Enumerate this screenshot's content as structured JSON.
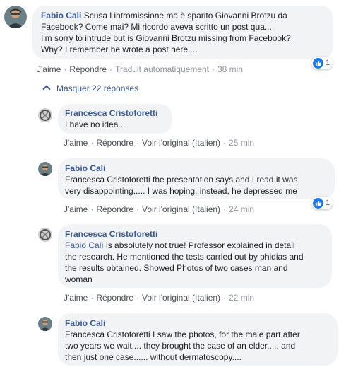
{
  "comments": [
    {
      "author": "Fabio Cali",
      "text": "Scusa l intromissione ma è sparito Giovanni Brotzu da Facebook? Come mai? Mi ricordo aveva scritto un post qua.... I'm sorry to intrude but is Giovanni Brotzu missing from Facebook? Why? I remember he wrote a post here....",
      "lines": [
        "Scusa l intromissione ma è sparito Giovanni Brotzu da",
        "Facebook? Come mai? Mi ricordo aveva scritto un post qua....",
        "I'm sorry to intrude but is Giovanni Brotzu missing from Facebook?",
        "Why? I remember he wrote a post here...."
      ],
      "actions": {
        "like": "J'aime",
        "reply": "Répondre",
        "translate": "Traduit automatiquement",
        "time": "38 min"
      },
      "reaction_count": "1"
    },
    {
      "author": "Francesca Cristoforetti",
      "lines": [
        "I have no idea..."
      ],
      "actions": {
        "like": "J'aime",
        "reply": "Répondre",
        "original": "Voir l'original (Italien)",
        "time": "25 min"
      }
    },
    {
      "author": "Fabio Cali",
      "lines": [
        "Francesca Cristoforetti the presentation says and I read it was",
        "very disappointing..... I was hoping, instead, he depressed me"
      ],
      "actions": {
        "like": "J'aime",
        "reply": "Répondre",
        "original": "Voir l'original (Italien)",
        "time": "24 min"
      },
      "reaction_count": "1"
    },
    {
      "author": "Francesca Cristoforetti",
      "mention": "Fabio Calì",
      "first_line_rest": " is absolutely not true! Professor explained in detail",
      "lines": [
        "the research. He mentioned the tests carried out by phidias and",
        "the results obtained. Showed Photos of two cases man and",
        "woman"
      ],
      "actions": {
        "like": "J'aime",
        "reply": "Répondre",
        "original": "Voir l'original (Italien)",
        "time": "22 min"
      }
    },
    {
      "author": "Fabio Cali",
      "lines": [
        "Francesca Cristoforetti I saw the photos, for the male part after",
        "two years we wait.... they brought the case of an elder..... and",
        "then just one case...... without dermatoscopy...."
      ]
    }
  ],
  "hide_replies": "Masquer 22 réponses",
  "colors": {
    "link": "#385898",
    "bubble": "#f2f3f5",
    "like": "#1877f2",
    "meta": "#606770"
  },
  "icons": {
    "reaction": "thumbs-up-icon",
    "toggle": "chevron-up-icon"
  }
}
